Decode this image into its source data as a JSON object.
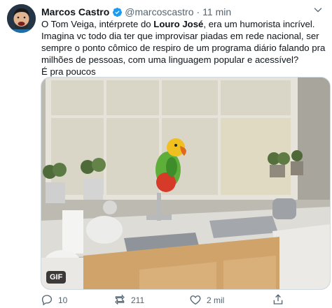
{
  "tweet": {
    "author_name": "Marcos Castro",
    "handle": "@marcoscastro",
    "separator": "·",
    "time": "11 min",
    "text_1": "O Tom Veiga, intérprete do ",
    "text_bold": "Louro José",
    "text_2": ", era um humorista incrível. Imagina vc todo dia ter que improvisar piadas em rede nacional, ser sempre o ponto cômico de respiro de um programa diário falando pra milhões de pessoas, com uma linguagem popular e acessível?",
    "text_3": "É pra poucos",
    "media_badge": "GIF"
  },
  "actions": {
    "replies": "10",
    "retweets": "211",
    "likes": "2 mil"
  },
  "colors": {
    "verified": "#1d9bf0",
    "muted": "#536471",
    "text": "#0f1419"
  },
  "icons": [
    "avatar-image",
    "verified-badge-icon",
    "chevron-down-icon",
    "reply-icon",
    "retweet-icon",
    "like-icon",
    "share-icon"
  ]
}
